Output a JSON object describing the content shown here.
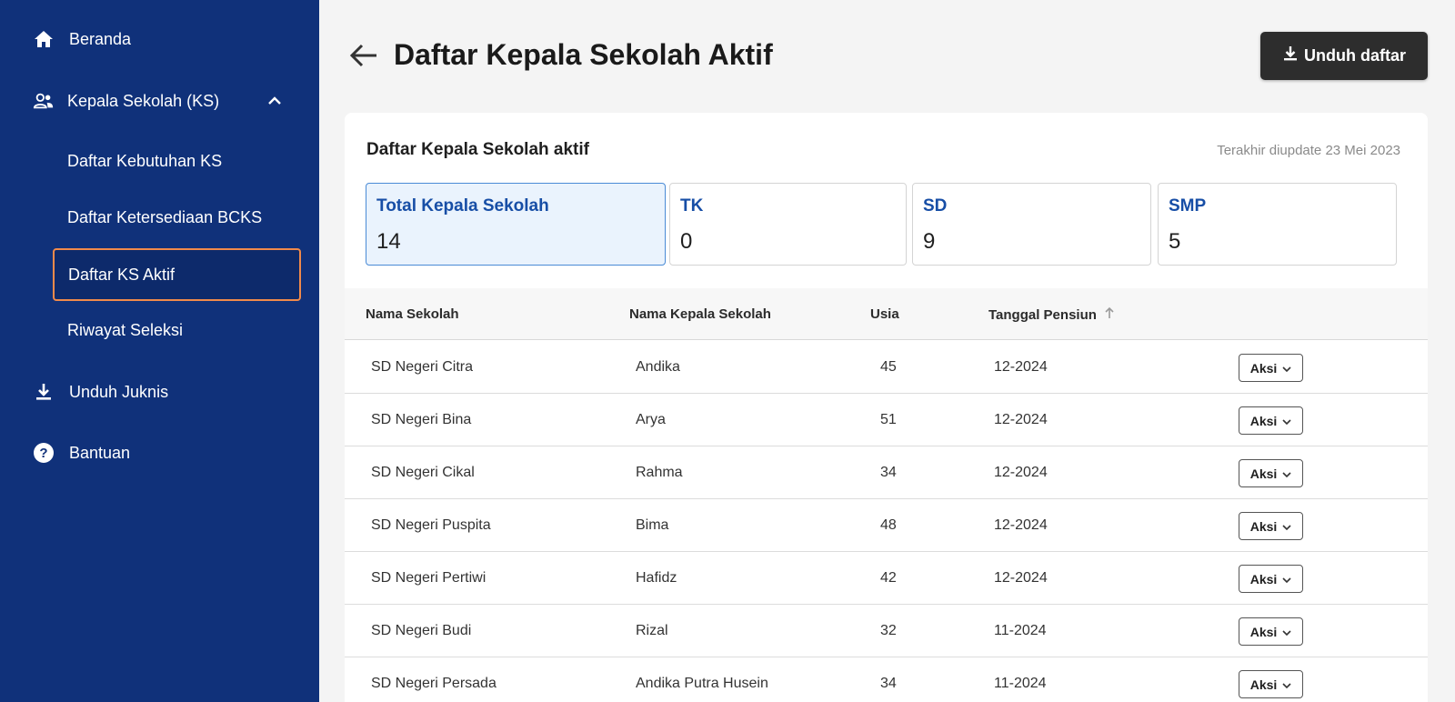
{
  "sidebar": {
    "items": [
      {
        "label": "Beranda",
        "icon": "home-icon"
      },
      {
        "label": "Kepala Sekolah (KS)",
        "icon": "users-icon",
        "expanded": true
      },
      {
        "label": "Unduh Juknis",
        "icon": "download-icon"
      },
      {
        "label": "Bantuan",
        "icon": "help-icon"
      }
    ],
    "sub_items": [
      {
        "label": "Daftar Kebutuhan KS"
      },
      {
        "label": "Daftar Ketersediaan BCKS"
      },
      {
        "label": "Daftar KS Aktif",
        "active": true
      },
      {
        "label": "Riwayat Seleksi"
      }
    ]
  },
  "header": {
    "title": "Daftar Kepala Sekolah Aktif",
    "download_label": "Unduh daftar"
  },
  "card": {
    "title": "Daftar Kepala Sekolah aktif",
    "updated": "Terakhir diupdate 23 Mei 2023",
    "stats": [
      {
        "label": "Total Kepala Sekolah",
        "value": "14"
      },
      {
        "label": "TK",
        "value": "0"
      },
      {
        "label": "SD",
        "value": "9"
      },
      {
        "label": "SMP",
        "value": "5"
      }
    ]
  },
  "table": {
    "columns": [
      "Nama Sekolah",
      "Nama Kepala Sekolah",
      "Usia",
      "Tanggal Pensiun"
    ],
    "action_label": "Aksi",
    "rows": [
      {
        "sekolah": "SD Negeri Citra",
        "kepala": "Andika",
        "usia": "45",
        "pensiun": "12-2024"
      },
      {
        "sekolah": "SD Negeri Bina",
        "kepala": "Arya",
        "usia": "51",
        "pensiun": "12-2024"
      },
      {
        "sekolah": "SD Negeri Cikal",
        "kepala": "Rahma",
        "usia": "34",
        "pensiun": "12-2024"
      },
      {
        "sekolah": "SD Negeri Puspita",
        "kepala": "Bima",
        "usia": "48",
        "pensiun": "12-2024"
      },
      {
        "sekolah": "SD Negeri Pertiwi",
        "kepala": "Hafidz",
        "usia": "42",
        "pensiun": "12-2024"
      },
      {
        "sekolah": "SD Negeri Budi",
        "kepala": "Rizal",
        "usia": "32",
        "pensiun": "11-2024"
      },
      {
        "sekolah": "SD Negeri Persada",
        "kepala": "Andika Putra Husein",
        "usia": "34",
        "pensiun": "11-2024"
      }
    ]
  },
  "colors": {
    "sidebar_bg": "#10317a",
    "active_outline": "#f08a4b",
    "stat_label": "#174ea6",
    "button_dark": "#2d2d2d"
  }
}
